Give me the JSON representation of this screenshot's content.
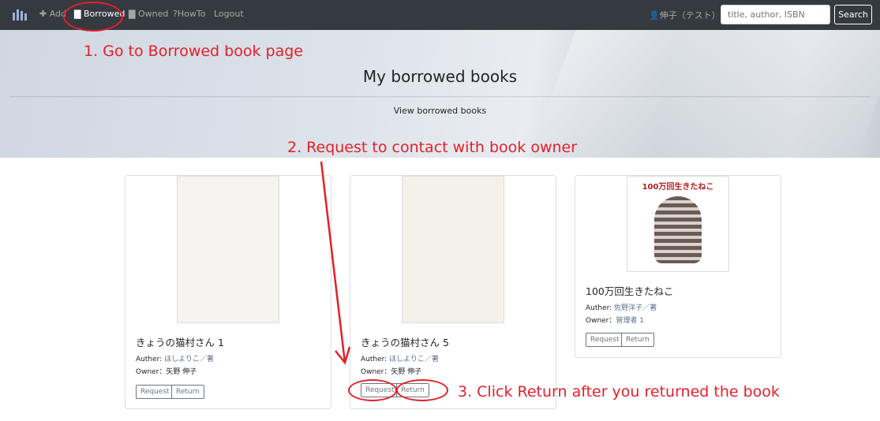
{
  "nav": {
    "add": "Add",
    "borrowed": "Borrowed",
    "owned": "Owned",
    "howto": "HowTo",
    "logout": "Logout",
    "user": "伸子（テスト）",
    "search_placeholder": "title, author, ISBN",
    "search_button": "Search"
  },
  "hero": {
    "title": "My borrowed books",
    "subtitle": "View borrowed books"
  },
  "books": [
    {
      "title": "きょうの猫村さん 1",
      "author_label": "Auther:",
      "author": "ほしよりこ／著",
      "owner_label": "Owner：",
      "owner": "矢野 伸子",
      "request": "Request",
      "return": "Return"
    },
    {
      "title": "きょうの猫村さん 5",
      "author_label": "Auther:",
      "author": "ほしよりこ／著",
      "owner_label": "Owner：",
      "owner": "矢野 伸子",
      "request": "Request",
      "return": "Return"
    },
    {
      "title": "100万回生きたねこ",
      "author_label": "Auther:",
      "author": "佐野洋子／著",
      "owner_label": "Owner：",
      "owner": "管理者 1",
      "request": "Request",
      "return": "Return",
      "cover_text": "100万回生きたねこ"
    }
  ],
  "annotations": {
    "step1": "1. Go to Borrowed book page",
    "step2": "2. Request to contact with book owner",
    "step3": "3. Click Return after you returned the book",
    "color": "#e3202b"
  }
}
